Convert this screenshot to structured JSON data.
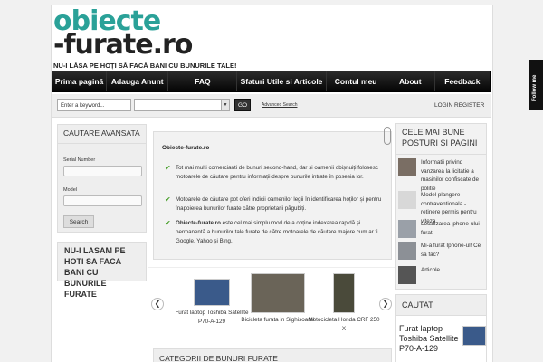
{
  "logo": {
    "line1": "obiecte",
    "line2": "-furate.ro"
  },
  "tagline": "NU-I LĂSA PE HOȚI SĂ FACĂ BANI CU BUNURILE TALE!",
  "nav": [
    "Prima pagină",
    "Adauga Anunt",
    "FAQ",
    "Sfaturi Utile si Articole",
    "Contul meu",
    "About",
    "Feedback"
  ],
  "search": {
    "keyword_placeholder": "Enter a keyword...",
    "go_label": "GO",
    "advanced_label": "Advanced Search",
    "login_label": "LOGIN REGISTER"
  },
  "advanced": {
    "title": "CAUTARE AVANSATA",
    "serial_label": "Serial Number",
    "model_label": "Model",
    "button": "Search"
  },
  "left_banner": "NU-I LASAM PE HOTI SA FACA BANI CU BUNURILE FURATE",
  "intro": {
    "title": "Obiecte-furate.ro",
    "bullets": [
      "Tot mai multi comercianti de bunuri second-hand, dar și oamenii obișnuiți folosesc motoarele de căutare pentru informații despre bunurile intrate în posesia lor.",
      "Motoarele de căutare pot oferi indicii oamenilor legii în identificarea hoților și pentru înapoierea bunurilor furate către proprietarii păgubiți.",
      "Obiecte-furate.ro este cel mai simplu mod de a obține indexarea rapidă și permanentă a bunurilor tale furate de către motoarele de căutare majore cum ar fi Google, Yahoo și Bing."
    ],
    "bold_lead": "Obiecte-furate.ro"
  },
  "slider": {
    "prev_icon": "chevron-left-icon",
    "next_icon": "chevron-right-icon",
    "items": [
      "Furat laptop Toshiba Satellite P70-A-129",
      "Bicicleta furata in Sighisoara!",
      "Motocicleta Honda CRF 250 X"
    ]
  },
  "categories_title": "CATEGORII DE BUNURI FURATE",
  "popular": {
    "title": "CELE MAI BUNE POSTURI ȘI PAGINI",
    "posts": [
      "Informatii privind vanzarea la licitatie a masinilor confiscate de politie",
      "Model plangere contraventionala - retinere permis pentru viteza",
      "Localizarea iphone-ului furat",
      "Mi-a furat Iphone-ul! Ce sa fac?",
      "Articole"
    ]
  },
  "wanted": {
    "title": "CAUTAT",
    "item": "Furat laptop Toshiba Satellite P70-A-129"
  },
  "follow_label": "Follow me",
  "colors": {
    "brand": "#2aa198",
    "nav": "#111111",
    "check": "#4aa02c"
  }
}
